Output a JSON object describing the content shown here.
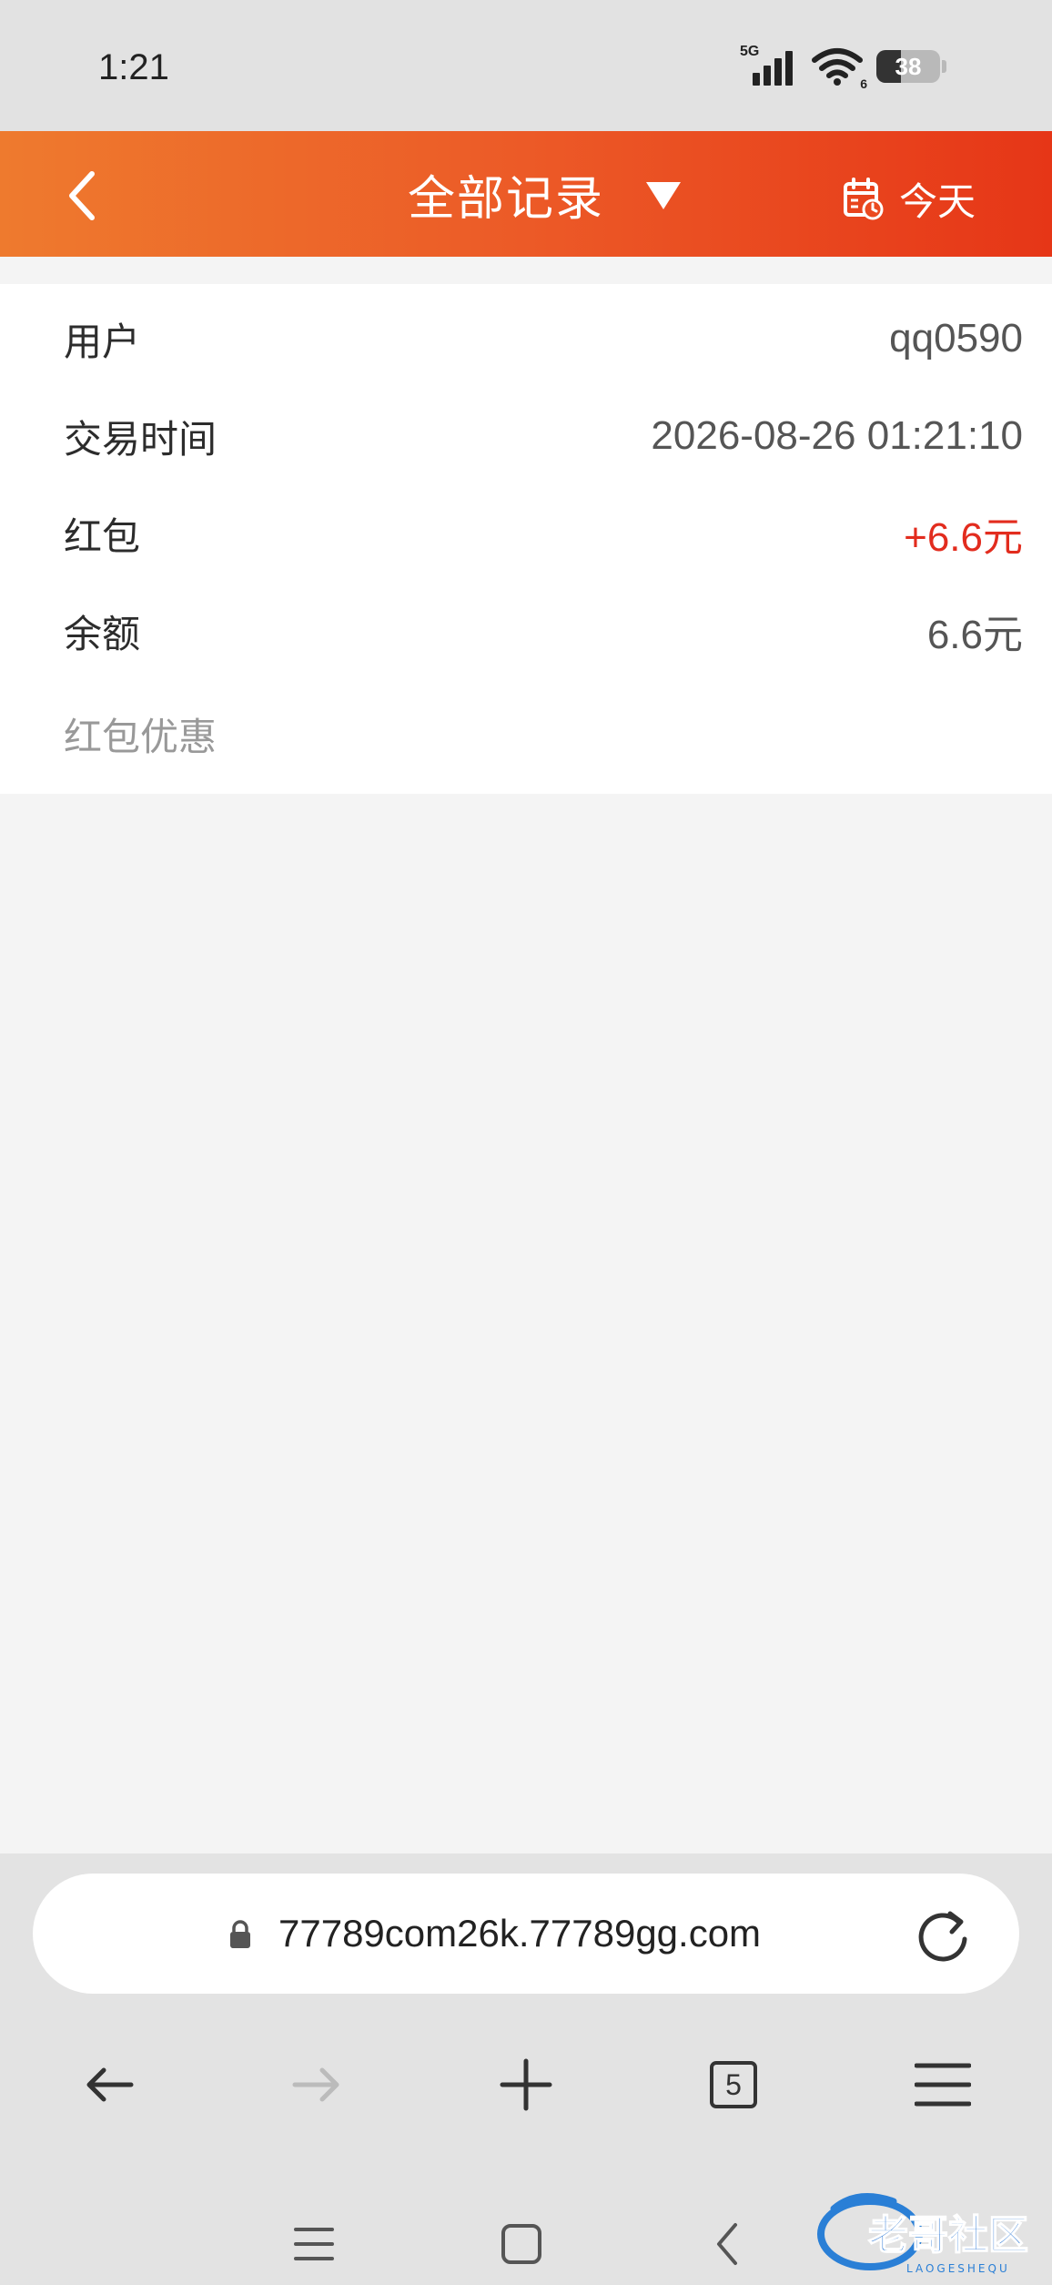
{
  "status_bar": {
    "time": "1:21",
    "network": "5G",
    "wifi_badge": "6",
    "battery": "38"
  },
  "header": {
    "title": "全部记录",
    "today_label": "今天",
    "accent_start": "#ee7a2e",
    "accent_end": "#e63617"
  },
  "details": {
    "rows": [
      {
        "label": "用户",
        "value": "qq0590"
      },
      {
        "label": "交易时间",
        "value": "2026-08-26 01:21:10"
      },
      {
        "label": "红包",
        "value": "+6.6元"
      },
      {
        "label": "余额",
        "value": "6.6元"
      }
    ],
    "note": "红包优惠",
    "positive_color": "#e22c1e"
  },
  "browser": {
    "url": "77789com26k.77789gg.com",
    "tab_count": "5",
    "icons": [
      "lock-icon",
      "reload-icon",
      "back-arrow-icon",
      "forward-arrow-icon",
      "plus-icon",
      "tabs-icon",
      "menu-icon"
    ]
  },
  "system_nav": {
    "icons": [
      "recents-icon",
      "home-icon",
      "system-back-icon"
    ]
  },
  "watermark": {
    "text": "老哥社区",
    "subtext": "LAOGESHEQU"
  }
}
